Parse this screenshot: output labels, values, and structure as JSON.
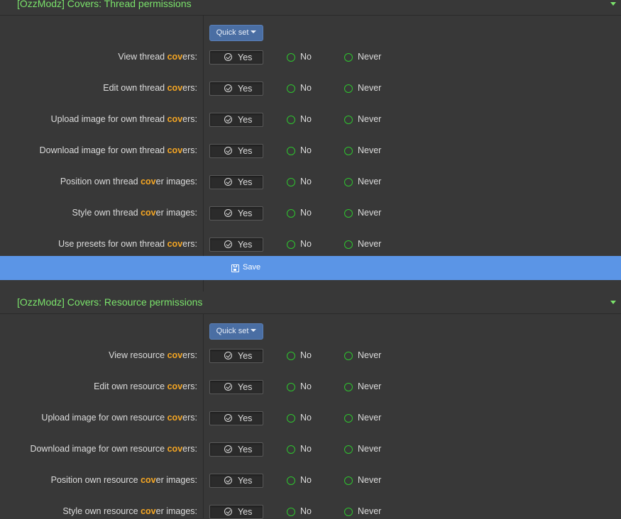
{
  "sections": [
    {
      "title": "[OzzModz] Covers: Thread permissions",
      "quick_set": "Quick set",
      "rows": [
        {
          "pre": "View thread ",
          "hl": "cov",
          "post": "ers:"
        },
        {
          "pre": "Edit own thread ",
          "hl": "cov",
          "post": "ers:"
        },
        {
          "pre": "Upload image for own thread ",
          "hl": "cov",
          "post": "ers:"
        },
        {
          "pre": "Download image for own thread ",
          "hl": "cov",
          "post": "ers:"
        },
        {
          "pre": "Position own thread ",
          "hl": "cov",
          "post": "er images:"
        },
        {
          "pre": "Style own thread ",
          "hl": "cov",
          "post": "er images:"
        },
        {
          "pre": "Use presets for own thread ",
          "hl": "cov",
          "post": "ers:"
        }
      ]
    },
    {
      "title": "[OzzModz] Covers: Resource permissions",
      "quick_set": "Quick set",
      "rows": [
        {
          "pre": "View resource ",
          "hl": "cov",
          "post": "ers:"
        },
        {
          "pre": "Edit own resource ",
          "hl": "cov",
          "post": "ers:"
        },
        {
          "pre": "Upload image for own resource ",
          "hl": "cov",
          "post": "ers:"
        },
        {
          "pre": "Download image for own resource ",
          "hl": "cov",
          "post": "ers:"
        },
        {
          "pre": "Position own resource ",
          "hl": "cov",
          "post": "er images:"
        },
        {
          "pre": "Style own resource ",
          "hl": "cov",
          "post": "er images:"
        }
      ]
    }
  ],
  "options": {
    "yes": "Yes",
    "no": "No",
    "never": "Never"
  },
  "save_label": "Save",
  "colors": {
    "accent_green": "#7be36b",
    "radio_green": "#2ec52e",
    "highlight": "#f5a623",
    "save_bar": "#5b95e6",
    "quick_set": "#4a6ea3"
  }
}
